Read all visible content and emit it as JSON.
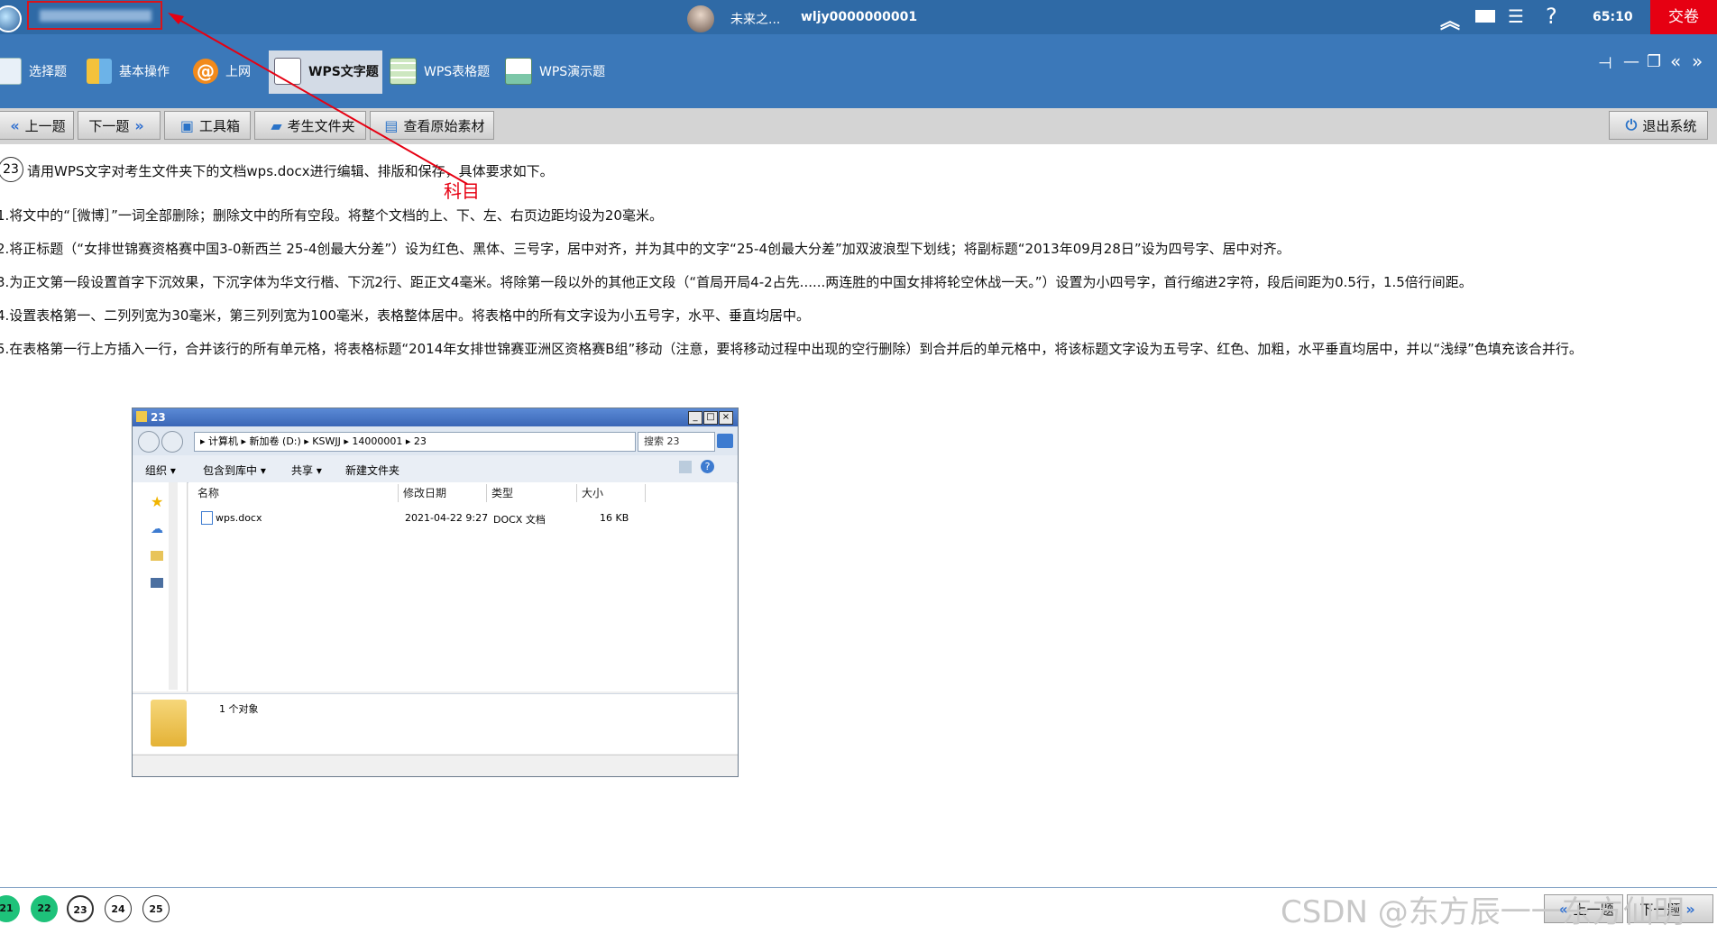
{
  "topbar": {
    "user_short_name": "未来之...",
    "user_id": "wljy0000000001",
    "timer": "65:10",
    "submit_label": "交卷",
    "icons": [
      "chevrons-up-icon",
      "screen-icon",
      "checklist-icon",
      "help-icon"
    ]
  },
  "toolbar": {
    "tabs": [
      {
        "label": "选择题",
        "icon": "list-icon"
      },
      {
        "label": "基本操作",
        "icon": "grid-icon"
      },
      {
        "label": "上网",
        "icon": "at-icon"
      },
      {
        "label": "WPS文字题",
        "icon": "document-icon"
      },
      {
        "label": "WPS表格题",
        "icon": "spreadsheet-icon"
      },
      {
        "label": "WPS演示题",
        "icon": "presentation-icon"
      }
    ],
    "window_controls": [
      "pin-icon",
      "minimize-icon",
      "restore-icon",
      "collapse-left-icon",
      "collapse-right-icon"
    ]
  },
  "nav": {
    "prev_label": "上一题",
    "next_label": "下一题",
    "toolbox_label": "工具箱",
    "folder_label": "考生文件夹",
    "material_label": "查看原始素材",
    "exit_label": "退出系统"
  },
  "question": {
    "number": "23",
    "intro": "请用WPS文字对考生文件夹下的文档wps.docx进行编辑、排版和保存，具体要求如下。",
    "items": [
      "1.将文中的“［微博］”一词全部删除；删除文中的所有空段。将整个文档的上、下、左、右页边距均设为20毫米。",
      "2.将正标题（“女排世锦赛资格赛中国3-0新西兰 25-4创最大分差”）设为红色、黑体、三号字，居中对齐，并为其中的文字“25-4创最大分差”加双波浪型下划线；将副标题“2013年09月28日”设为四号字、居中对齐。",
      "3.为正文第一段设置首字下沉效果，下沉字体为华文行楷、下沉2行、距正文4毫米。将除第一段以外的其他正文段（“首局开局4-2占先......两连胜的中国女排将轮空休战一天。”）设置为小四号字，首行缩进2字符，段后间距为0.5行，1.5倍行间距。",
      "4.设置表格第一、二列列宽为30毫米，第三列列宽为100毫米，表格整体居中。将表格中的所有文字设为小五号字，水平、垂直均居中。",
      "5.在表格第一行上方插入一行，合并该行的所有单元格，将表格标题“2014年女排世锦赛亚洲区资格赛B组”移动（注意，要将移动过程中出现的空行删除）到合并后的单元格中，将该标题文字设为五号字、红色、加粗，水平垂直均居中，并以“浅绿”色填充该合并行。"
    ]
  },
  "annotation": {
    "label": "科目",
    "color": "#e60012"
  },
  "explorer": {
    "title": "23",
    "breadcrumb": "▸ 计算机 ▸ 新加卷 (D:) ▸ KSWJJ ▸ 14000001 ▸ 23",
    "search_placeholder": "搜索 23",
    "commands": [
      "组织 ▾",
      "包含到库中 ▾",
      "共享 ▾",
      "新建文件夹"
    ],
    "columns": [
      "名称",
      "修改日期",
      "类型",
      "大小"
    ],
    "files": [
      {
        "name": "wps.docx",
        "modified": "2021-04-22 9:27",
        "type": "DOCX 文档",
        "size": "16 KB"
      }
    ],
    "status": "1 个对象"
  },
  "bottom": {
    "question_numbers": [
      {
        "n": "21",
        "state": "done"
      },
      {
        "n": "22",
        "state": "done"
      },
      {
        "n": "23",
        "state": "current"
      },
      {
        "n": "24",
        "state": "todo"
      },
      {
        "n": "25",
        "state": "todo"
      }
    ],
    "watermark": "CSDN @东方辰一一东方仙明",
    "prev_label": "上一题",
    "next_label": "下一题"
  },
  "colors": {
    "topbar": "#2f6aa6",
    "toolbar": "#3b78b9",
    "submit": "#e60012",
    "done_circle": "#1ec27a"
  }
}
